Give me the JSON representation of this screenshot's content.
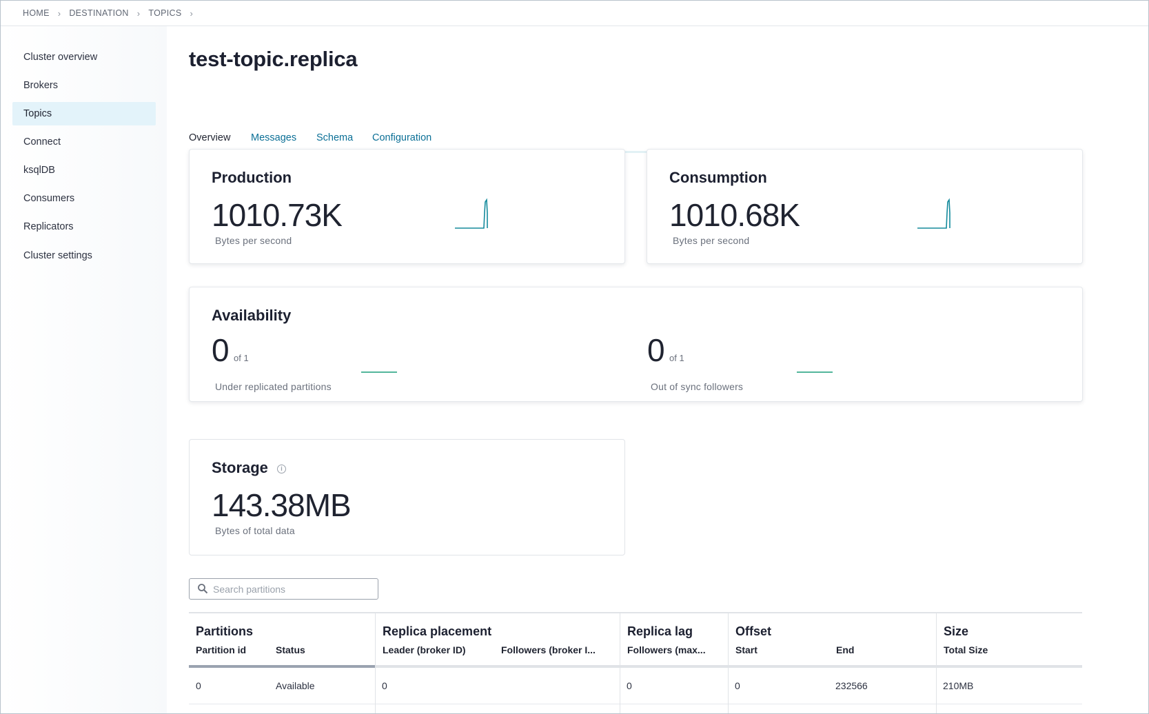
{
  "breadcrumb": [
    "HOME",
    "DESTINATION",
    "TOPICS"
  ],
  "sidebar": {
    "items": [
      {
        "label": "Cluster overview"
      },
      {
        "label": "Brokers"
      },
      {
        "label": "Topics",
        "active": true
      },
      {
        "label": "Connect"
      },
      {
        "label": "ksqlDB"
      },
      {
        "label": "Consumers"
      },
      {
        "label": "Replicators"
      },
      {
        "label": "Cluster settings"
      }
    ]
  },
  "page": {
    "title": "test-topic.replica"
  },
  "tabs": [
    {
      "label": "Overview",
      "active": true
    },
    {
      "label": "Messages"
    },
    {
      "label": "Schema"
    },
    {
      "label": "Configuration"
    }
  ],
  "production": {
    "title": "Production",
    "value": "1010.73K",
    "label": "Bytes per second"
  },
  "consumption": {
    "title": "Consumption",
    "value": "1010.68K",
    "label": "Bytes per second"
  },
  "availability": {
    "title": "Availability",
    "under_replicated": {
      "value": "0",
      "of": "of 1",
      "label": "Under replicated partitions"
    },
    "out_of_sync": {
      "value": "0",
      "of": "of 1",
      "label": "Out of sync followers"
    }
  },
  "storage": {
    "title": "Storage",
    "value": "143.38MB",
    "label": "Bytes of total data",
    "icon": "info-icon"
  },
  "search": {
    "placeholder": "Search partitions",
    "value": ""
  },
  "table": {
    "groups": {
      "partitions": {
        "title": "Partitions",
        "cols": [
          "Partition id",
          "Status"
        ]
      },
      "replica_placement": {
        "title": "Replica placement",
        "cols": [
          "Leader (broker ID)",
          "Followers (broker I..."
        ]
      },
      "replica_lag": {
        "title": "Replica lag",
        "cols": [
          "Followers (max..."
        ]
      },
      "offset": {
        "title": "Offset",
        "cols": [
          "Start",
          "End"
        ]
      },
      "size": {
        "title": "Size",
        "cols": [
          "Total Size"
        ]
      }
    },
    "rows": [
      {
        "partition_id": "0",
        "status": "Available",
        "leader": "0",
        "followers": "",
        "lag": "0",
        "start": "0",
        "end": "232566",
        "size": "210MB"
      }
    ]
  },
  "colors": {
    "accent": "#0b6f96",
    "spark_teal": "#138a9c",
    "spark_green": "#1a9e7a"
  }
}
